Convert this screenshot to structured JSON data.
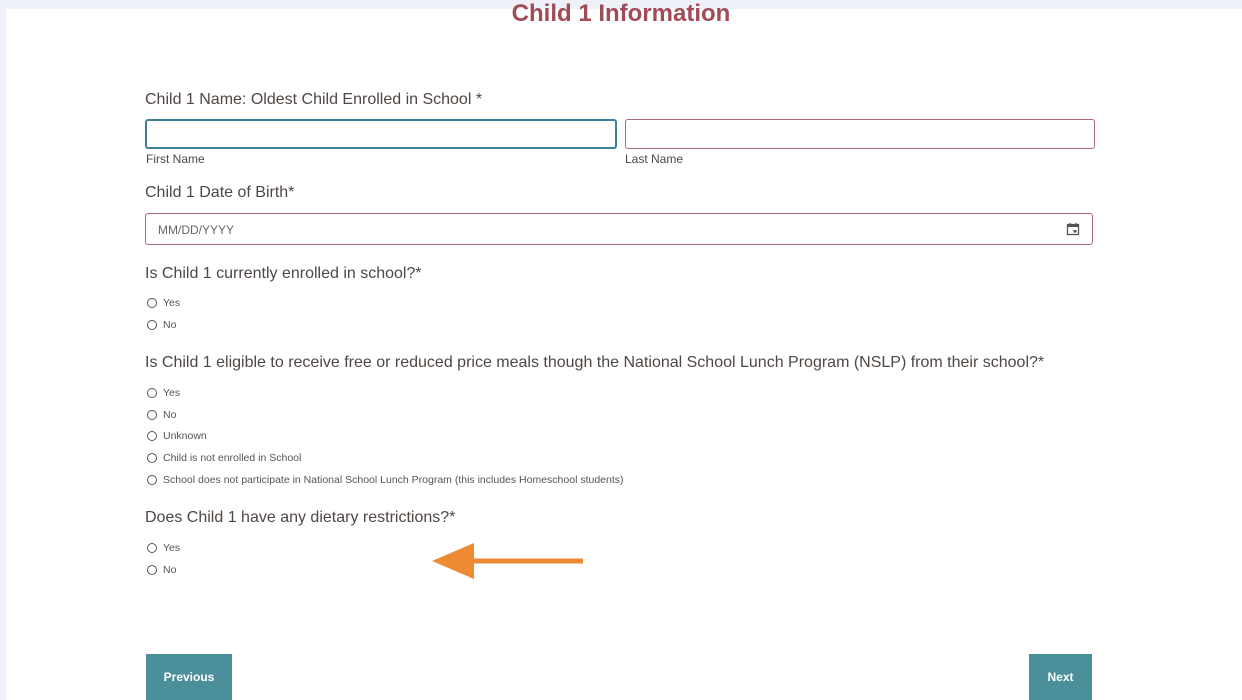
{
  "page_title": "Child 1 Information",
  "name": {
    "label": "Child 1 Name: Oldest Child Enrolled in School *",
    "first_label": "First Name",
    "last_label": "Last Name",
    "first_value": "",
    "last_value": ""
  },
  "dob": {
    "label": "Child 1 Date of Birth*",
    "placeholder": "MM/DD/YYYY",
    "icon": "calendar-icon"
  },
  "enrolled": {
    "label": "Is Child 1 currently enrolled in school?*",
    "options": [
      "Yes",
      "No"
    ]
  },
  "nslp": {
    "label": "Is Child 1 eligible to receive free or reduced price meals though the National School Lunch Program (NSLP) from their school?*",
    "options": [
      "Yes",
      "No",
      "Unknown",
      "Child is not enrolled in School",
      "School does not participate in National School Lunch Program (this includes Homeschool students)"
    ]
  },
  "dietary": {
    "label": "Does Child 1 have any dietary restrictions?*",
    "options": [
      "Yes",
      "No"
    ]
  },
  "annotation": {
    "icon": "arrow-left-icon",
    "color": "#ee8a34"
  },
  "buttons": {
    "previous": "Previous",
    "next": "Next"
  },
  "colors": {
    "title": "#a14b55",
    "button": "#4a8f99",
    "focus_border": "#3e7f9c",
    "input_border": "#a86a6f"
  }
}
